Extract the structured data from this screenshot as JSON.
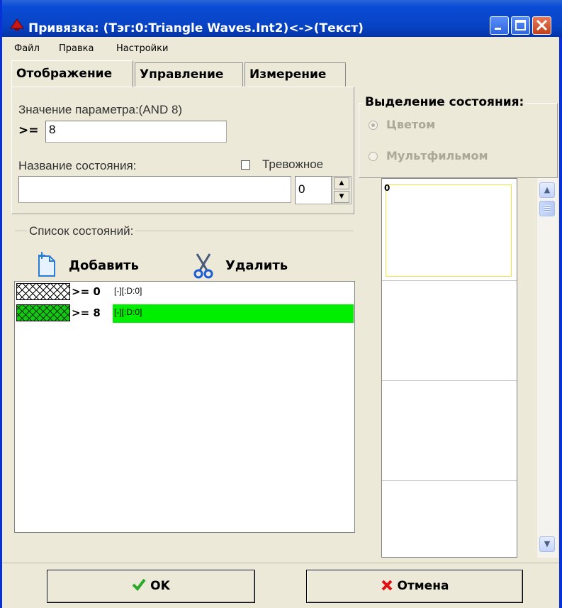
{
  "window": {
    "title": "Привязка: (Тэг:0:Triangle Waves.Int2)<->(Текст)",
    "controls": [
      "minimize",
      "maximize",
      "close"
    ],
    "accent_color": "#0a4cd6"
  },
  "menu": [
    "Файл",
    "Правка",
    "Настройки"
  ],
  "tabs": [
    {
      "label": "Отображение",
      "active": true
    },
    {
      "label": "Управление",
      "active": false
    },
    {
      "label": "Измерение",
      "active": false
    }
  ],
  "form": {
    "param_label": "Значение параметра:(AND 8)",
    "operator": ">=",
    "param_value": "8",
    "state_name_label": "Название состояния:",
    "alarm_checkbox_label": "Тревожное",
    "alarm_checked": false,
    "state_name_value": "",
    "spin_value": "0"
  },
  "states_group": {
    "title": "Список состояний:",
    "add_label": "Добавить",
    "delete_label": "Удалить",
    "items": [
      {
        "op": ">= 0",
        "info": "[-][:D:0]",
        "swatch_color": "#ffffff",
        "highlight": false
      },
      {
        "op": ">= 8",
        "info": "[-][:D:0]",
        "swatch_color": "#14c814",
        "highlight": true
      }
    ]
  },
  "highlight_group": {
    "title": "Выделение состояния:",
    "options": [
      {
        "label": "Цветом",
        "selected": true
      },
      {
        "label": "Мультфильмом",
        "selected": false
      }
    ]
  },
  "preview": {
    "first_cell_text": "0",
    "selection_color": "#f0e040"
  },
  "buttons": {
    "ok_label": "OK",
    "cancel_label": "Отмена"
  },
  "icons": {
    "app": "bell-icon",
    "add": "new-document-icon",
    "delete": "scissors-icon",
    "ok": "checkmark-icon",
    "cancel": "cross-icon"
  }
}
